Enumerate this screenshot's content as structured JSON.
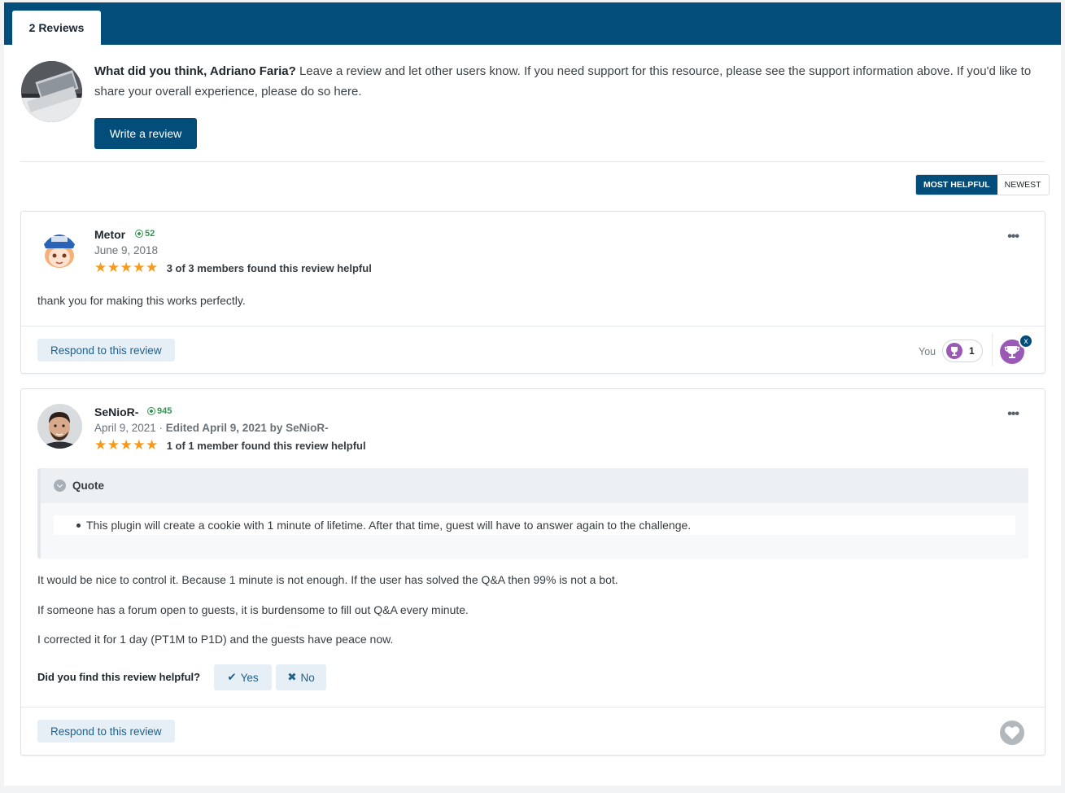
{
  "tabs": {
    "reviews": "2 Reviews"
  },
  "prompt": {
    "question": "What did you think, Adriano Faria?",
    "text": " Leave a review and let other users know. If you need support for this resource, please see the support information above. If you'd like to share your overall experience, please do so here.",
    "write_button": "Write a review"
  },
  "sort": {
    "most_helpful": "MOST HELPFUL",
    "newest": "NEWEST"
  },
  "colors": {
    "brand": "#034d7a",
    "star": "#f49b1d",
    "rep": "#2f9a4f",
    "trophy": "#9b59b6"
  },
  "reviews": [
    {
      "author": "Metor",
      "reputation": "52",
      "date": "June 9, 2018",
      "stars": "★★★★★",
      "rating": 5,
      "helpful_text": "3 of 3 members found this review helpful",
      "paragraphs": [
        "thank you for making this works perfectly."
      ],
      "respond": "Respond to this review",
      "reaction_you": "You",
      "reaction_count": "1",
      "remove_reaction": "x",
      "more": "•••"
    },
    {
      "author": "SeNioR-",
      "reputation": "945",
      "date": "April 9, 2021 · ",
      "edited": "Edited April 9, 2021 by SeNioR-",
      "stars": "★★★★★",
      "rating": 5,
      "helpful_text": "1 of 1 member found this review helpful",
      "quote_label": "Quote",
      "quote_item": "This plugin will create a cookie with 1 minute of lifetime. After that time, guest will have to answer again to the challenge.",
      "paragraphs": [
        "It would be nice to control it. Because 1 minute is not enough. If the user has solved the Q&A then 99% is not a bot.",
        "If someone has a forum open to guests, it is burdensome to fill out Q&A every minute.",
        "I corrected it for 1 day (PT1M to P1D) and the guests have peace now."
      ],
      "helpful_question": "Did you find this review helpful?",
      "yes": "Yes",
      "no": "No",
      "yes_icon": "✔",
      "no_icon": "✖",
      "respond": "Respond to this review",
      "more": "•••"
    }
  ]
}
